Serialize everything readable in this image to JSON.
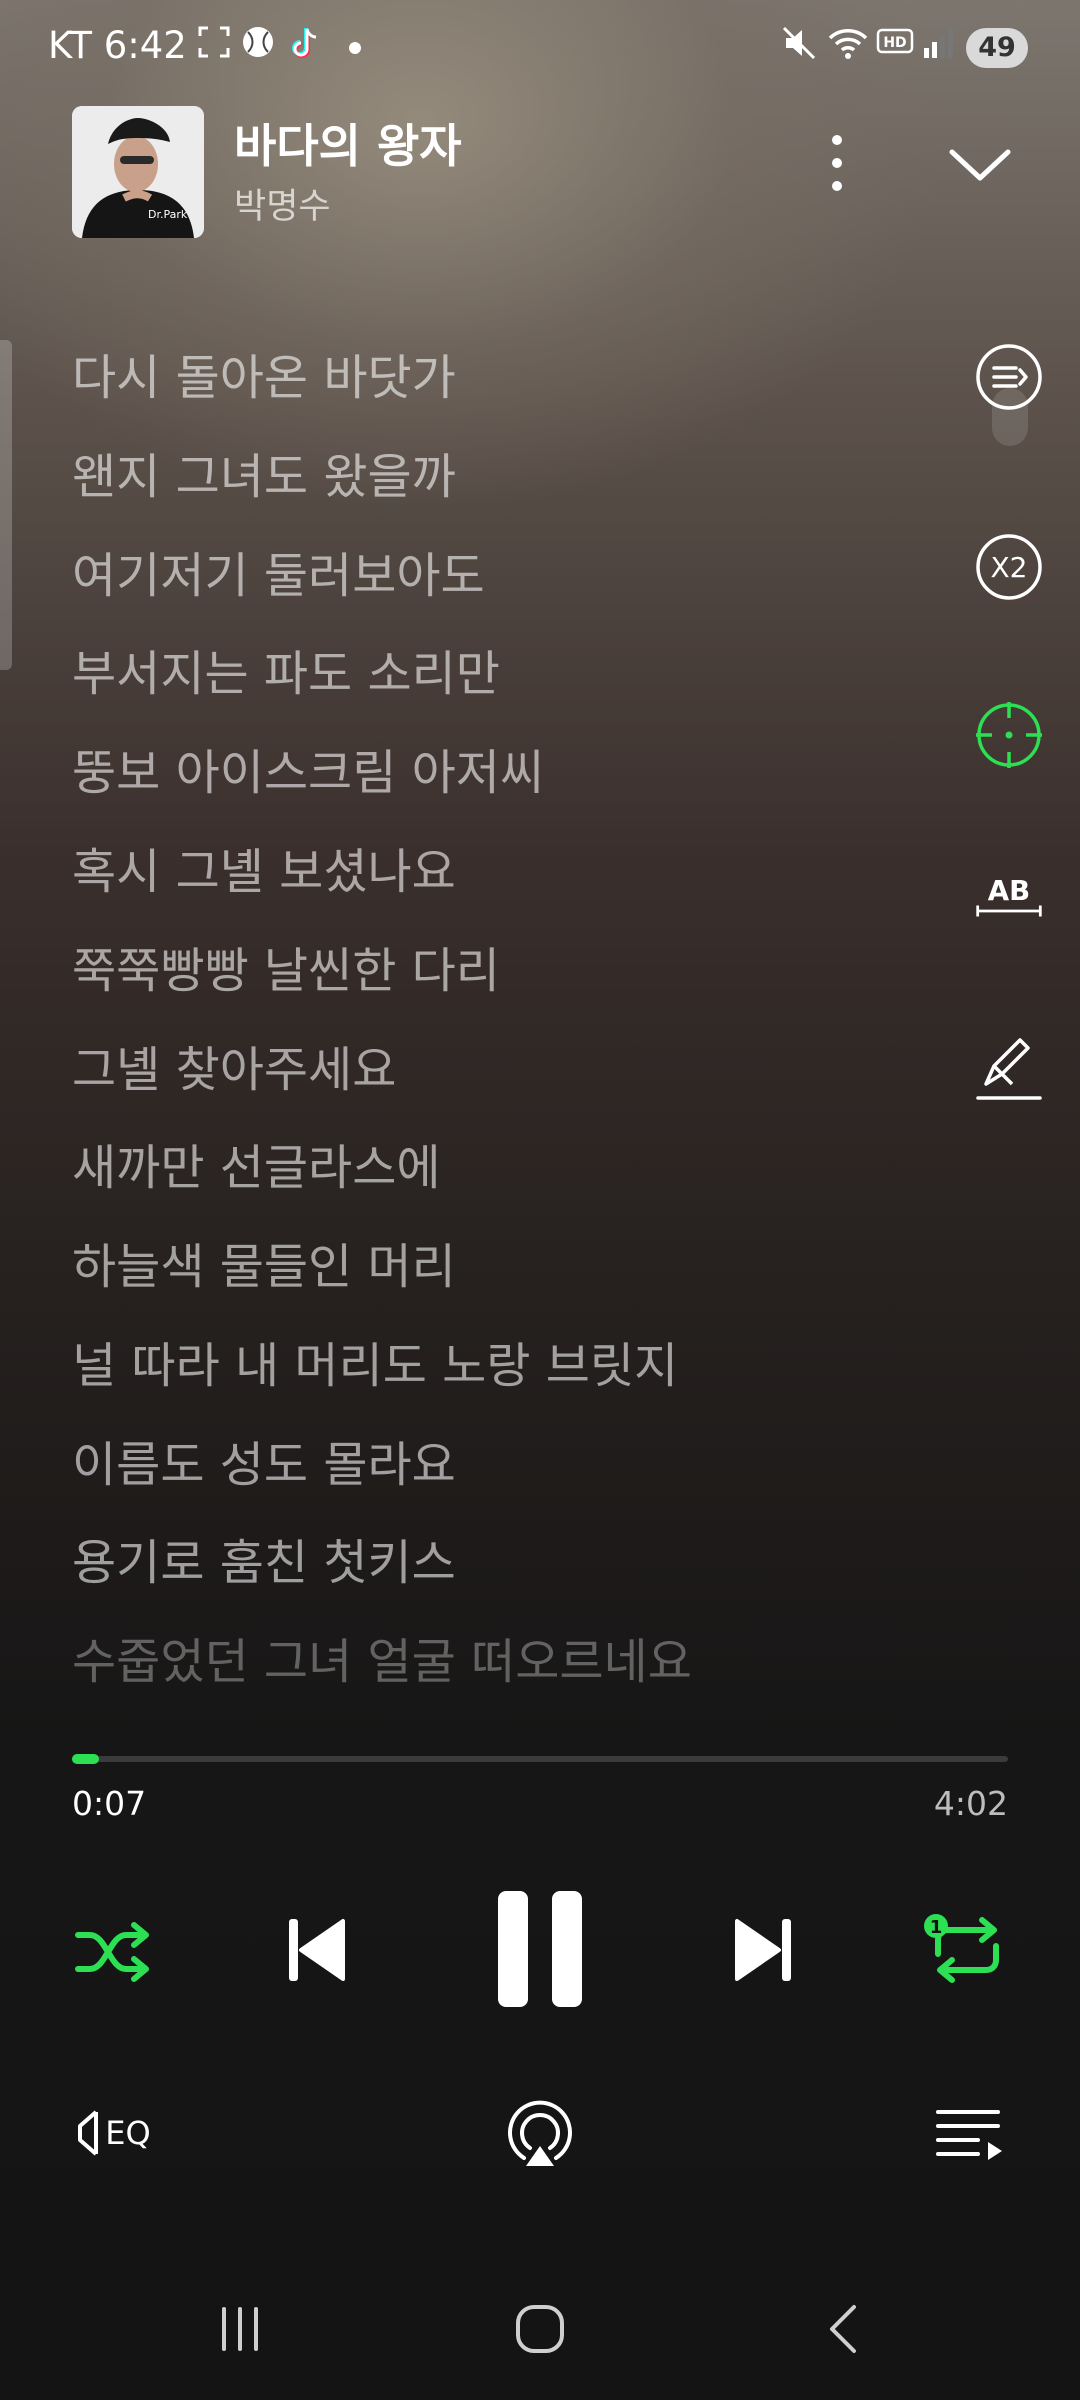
{
  "status_bar": {
    "carrier_time": "KT 6:42",
    "battery": "49",
    "icons": [
      "screen-record-icon",
      "ball-icon",
      "tiktok-icon",
      "dot-icon",
      "mute-icon",
      "wifi-icon",
      "hd-icon",
      "signal-icon",
      "battery-icon"
    ]
  },
  "header": {
    "title": "바다의 왕자",
    "artist": "박명수",
    "album_shirt_text": "Dr.Park"
  },
  "lyrics": [
    "다시 돌아온 바닷가",
    "왠지 그녀도 왔을까",
    "여기저기 둘러보아도",
    "부서지는 파도 소리만",
    "뚱보 아이스크림 아저씨",
    "혹시 그녤 보셨나요",
    "쭉쭉빵빵 날씬한 다리",
    "그녤 찾아주세요",
    "새까만 선글라스에",
    "하늘색 물들인 머리",
    "널 따라 내 머리도 노랑 브릿지",
    "이름도 성도 몰라요",
    "용기로 훔친 첫키스",
    "수줍었던 그녀 얼굴 떠오르네요"
  ],
  "side_tools": {
    "speed_label": "X2",
    "translate_label": "AB"
  },
  "player": {
    "current_time": "0:07",
    "total_time": "4:02",
    "progress": 0.029,
    "repeat_badge": "1"
  },
  "tools": {
    "eq_label": "EQ"
  },
  "colors": {
    "accent": "#2ddf52",
    "lyric_text": "#a9a3a0"
  }
}
